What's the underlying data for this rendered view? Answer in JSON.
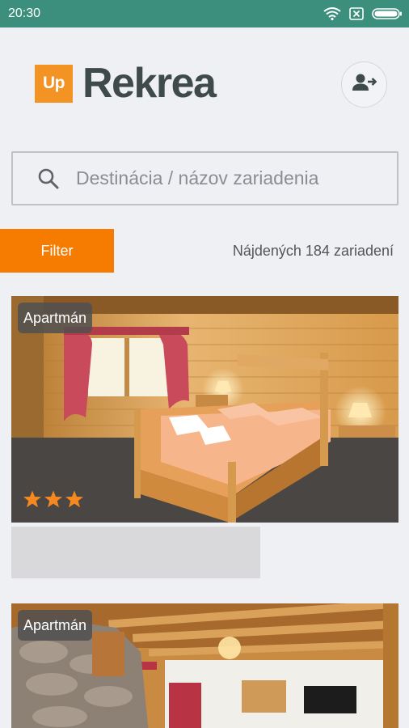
{
  "status_bar": {
    "time": "20:30"
  },
  "header": {
    "logo_badge": "Up",
    "logo_name": "Rekrea"
  },
  "search": {
    "placeholder": "Destinácia / názov zariadenia"
  },
  "filter": {
    "button_label": "Filter",
    "found_text": "Nájdených 184 zariadení"
  },
  "listings": [
    {
      "badge": "Apartmán",
      "stars": 3
    },
    {
      "badge": "Apartmán"
    }
  ],
  "colors": {
    "accent": "#f57c00",
    "status_bar": "#3d8f7d",
    "logo_orange": "#f39324"
  }
}
